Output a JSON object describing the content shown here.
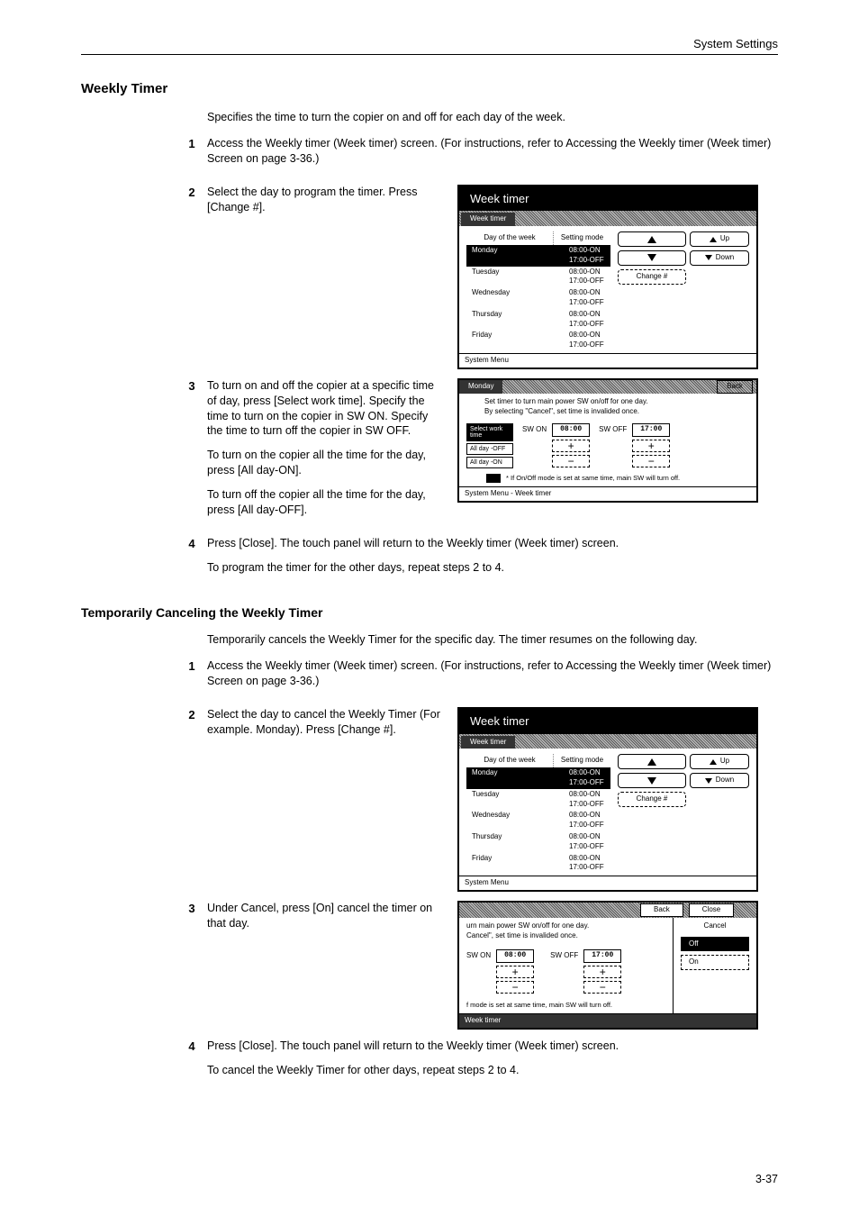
{
  "header": {
    "section": "System Settings"
  },
  "h": {
    "weekly_timer": "Weekly Timer",
    "cancel": "Temporarily Canceling the Weekly Timer"
  },
  "wt_intro": "Specifies the time to turn the copier on and off for each day of the week.",
  "cancel_intro": "Temporarily cancels the Weekly Timer for the specific day. The timer resumes on the following day.",
  "wt_steps": {
    "s1": "Access the Weekly timer (Week timer) screen. (For instructions, refer to Accessing the Weekly timer (Week timer) Screen on page 3-36.)",
    "s2": "Select the day to program the timer. Press [Change #].",
    "s3a": "To turn on and off the copier at a specific time of day, press [Select work time]. Specify the time to turn on the copier in SW ON. Specify the time to turn off the copier in SW OFF.",
    "s3b": "To turn on the copier all the time for the day, press [All day-ON].",
    "s3c": "To turn off the copier all the time for the day, press [All day-OFF].",
    "s4a": "Press [Close]. The touch panel will return to the Weekly timer (Week timer) screen.",
    "s4b": "To program the timer for the other days, repeat steps 2 to 4."
  },
  "cx_steps": {
    "s1": "Access the Weekly timer (Week timer) screen. (For instructions, refer to Accessing the Weekly timer (Week timer) Screen on page 3-36.)",
    "s2": "Select the day to cancel the Weekly Timer (For example. Monday). Press [Change #].",
    "s3": "Under Cancel, press [On] cancel the timer on that day.",
    "s4a": "Press [Close]. The touch panel will return to the Weekly timer (Week timer) screen.",
    "s4b": "To cancel the Weekly Timer for other days, repeat steps 2 to 4."
  },
  "scr1": {
    "title": "Week timer",
    "tab": "Week timer",
    "col_dow": "Day of the week",
    "col_set": "Setting mode",
    "rows": [
      {
        "d": "Monday",
        "s": "08:00-ON  17:00-OFF"
      },
      {
        "d": "Tuesday",
        "s": "08:00-ON  17:00-OFF"
      },
      {
        "d": "Wednesday",
        "s": "08:00-ON  17:00-OFF"
      },
      {
        "d": "Thursday",
        "s": "08:00-ON  17:00-OFF"
      },
      {
        "d": "Friday",
        "s": "08:00-ON  17:00-OFF"
      }
    ],
    "up": "Up",
    "down": "Down",
    "change": "Change #",
    "sys": "System Menu"
  },
  "scr2": {
    "tab": "Monday",
    "back": "Back",
    "msg1": "Set timer to turn main power SW on/off for one day.",
    "msg2": "By selecting \"Cancel\", set time is invalided once.",
    "side": [
      "Select work time",
      "All day -OFF",
      "All day -ON"
    ],
    "swon": "SW ON",
    "swoff": "SW OFF",
    "on_t": "08:00",
    "off_t": "17:00",
    "note": "* If On/Off mode is set at same time, main SW will turn off.",
    "sys": "System Menu      -   Week timer"
  },
  "scr3": {
    "back": "Back",
    "close": "Close",
    "msg1": "urn main power SW on/off for one day.",
    "msg2": "Cancel\", set time is invalided once.",
    "swon": "SW ON",
    "swoff": "SW OFF",
    "on_t": "08:00",
    "off_t": "17:00",
    "note": "f mode is set at same time, main SW will turn off.",
    "cancel": "Cancel",
    "off": "Off",
    "on": "On",
    "sys": "Week timer"
  },
  "footer": "3-37"
}
